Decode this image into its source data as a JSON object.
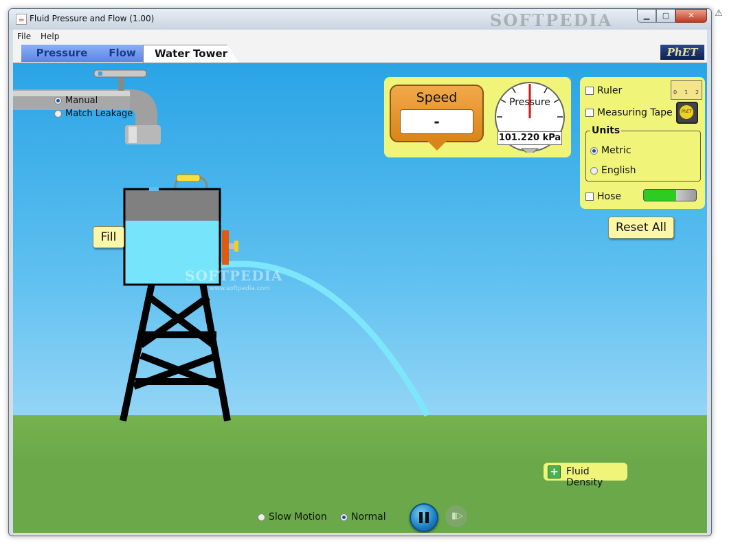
{
  "window": {
    "title": "Fluid Pressure and Flow (1.00)",
    "watermark": "SOFTPEDIA",
    "minimize_icon": "minimize-icon",
    "maximize_icon": "maximize-icon",
    "close_icon": "close-icon"
  },
  "menu": {
    "items": [
      "File",
      "Help"
    ]
  },
  "tabs": [
    {
      "label": "Pressure",
      "active": false
    },
    {
      "label": "Flow",
      "active": false
    },
    {
      "label": "Water Tower",
      "active": true
    }
  ],
  "logo": "PhET",
  "faucet": {
    "options": [
      {
        "label": "Manual",
        "selected": true
      },
      {
        "label": "Match Leakage",
        "selected": false
      }
    ]
  },
  "tank": {
    "fill_button": "Fill",
    "water_level_fraction": 0.69
  },
  "speed": {
    "label": "Speed",
    "value": "-"
  },
  "pressure": {
    "label": "Pressure",
    "value": "101.220 kPa"
  },
  "tools": {
    "ruler": {
      "label": "Ruler",
      "checked": false,
      "icon": "ruler-icon",
      "ticks": [
        "0",
        "1",
        "2"
      ]
    },
    "measuring_tape": {
      "label": "Measuring Tape",
      "checked": false,
      "icon": "measuring-tape-icon",
      "icon_text": "PhET"
    },
    "units": {
      "title": "Units",
      "options": [
        {
          "label": "Metric",
          "selected": true
        },
        {
          "label": "English",
          "selected": false
        }
      ]
    },
    "hose": {
      "label": "Hose",
      "checked": false,
      "icon": "hose-icon"
    }
  },
  "reset_all": "Reset All",
  "fluid_density": {
    "label": "Fluid Density",
    "icon": "plus-icon"
  },
  "playback": {
    "speeds": [
      {
        "label": "Slow Motion",
        "selected": false
      },
      {
        "label": "Normal",
        "selected": true
      }
    ],
    "pause_icon": "pause-icon",
    "step_icon": "step-icon"
  },
  "watermark_center": "SOFTPEDIA",
  "watermark_url": "www.softpedia.com",
  "colors": {
    "sky": "#2aa4e6",
    "ground": "#6aa84a",
    "water": "#76e4fb",
    "panel": "#f0f57a",
    "speed_box": "#d98519"
  }
}
